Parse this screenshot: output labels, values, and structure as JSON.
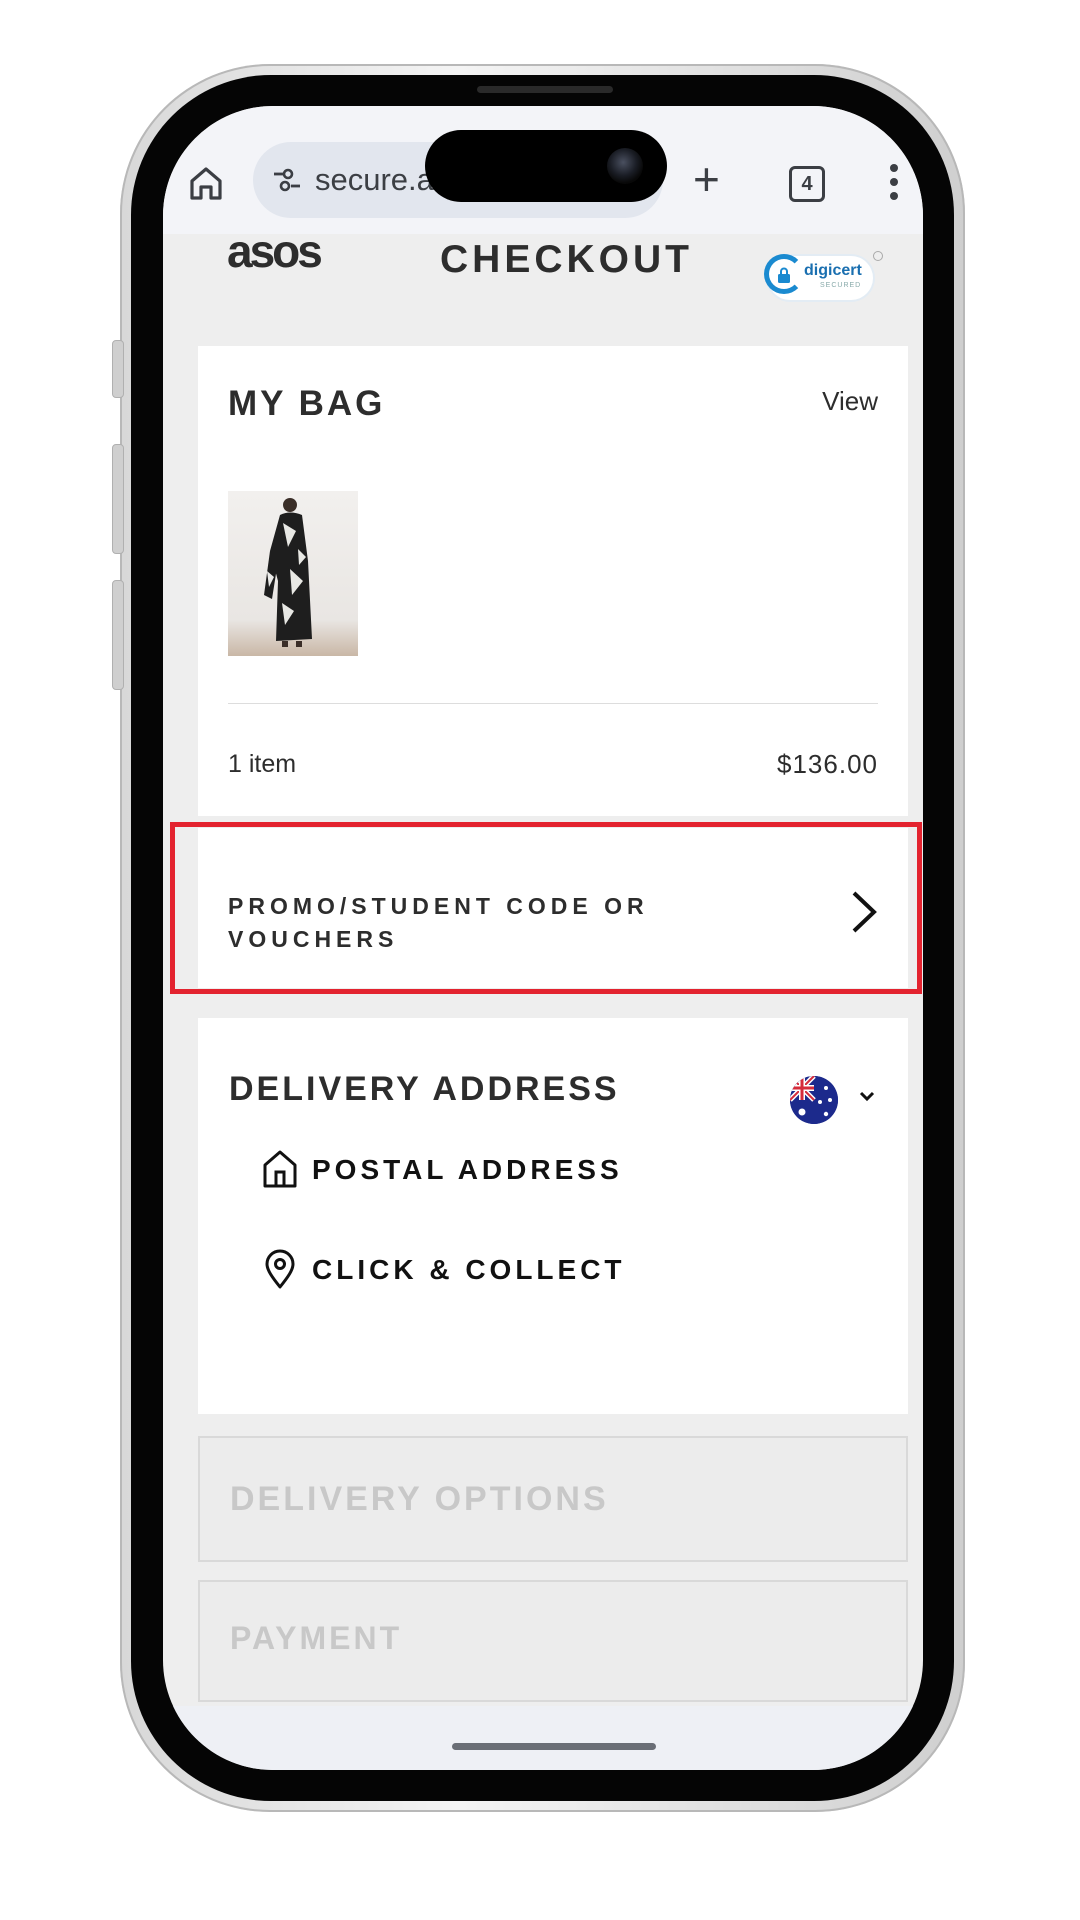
{
  "browser": {
    "url_display": "secure.a",
    "tab_count": "4",
    "icons": [
      "home-icon",
      "site-settings-icon",
      "new-tab-plus-icon",
      "tab-switcher-icon",
      "more-menu-icon"
    ]
  },
  "header": {
    "logo": "asos",
    "title": "CHECKOUT",
    "badge_brand": "digicert",
    "badge_sub": "SECURED"
  },
  "bag": {
    "heading": "MY BAG",
    "view_link": "View",
    "item_count": "1 item",
    "total": "$136.00"
  },
  "promo": {
    "label": "PROMO/STUDENT CODE OR VOUCHERS",
    "highlight_color": "#e3232f"
  },
  "delivery": {
    "heading": "DELIVERY ADDRESS",
    "country_flag": "australia-flag",
    "options": [
      {
        "label": "POSTAL ADDRESS",
        "icon": "house-icon"
      },
      {
        "label": "CLICK & COLLECT",
        "icon": "location-pin-icon"
      }
    ]
  },
  "sections": {
    "delivery_options": "DELIVERY OPTIONS",
    "payment": "PAYMENT"
  },
  "colors": {
    "text": "#2d2d2d",
    "disabled_text": "#c8c8c8",
    "page_bg": "#eeeeee",
    "digicert_blue": "#1a8ad0"
  }
}
